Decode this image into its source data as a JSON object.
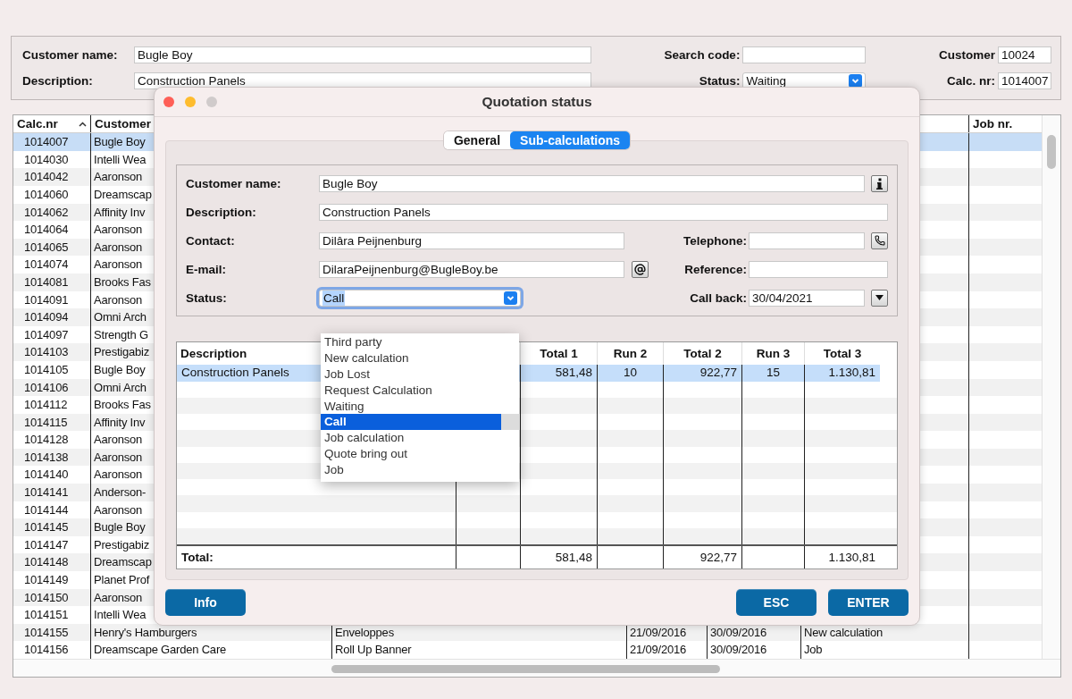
{
  "search_form": {
    "customer_name": {
      "label": "Customer name:",
      "value": "Bugle Boy"
    },
    "description": {
      "label": "Description:",
      "value": "Construction Panels"
    },
    "search_code": {
      "label": "Search code:"
    },
    "status": {
      "label": "Status:",
      "value": "Waiting"
    },
    "customer": {
      "label": "Customer",
      "value": "10024"
    },
    "calc_nr": {
      "label": "Calc. nr:",
      "value": "1014007"
    }
  },
  "table": {
    "columns": [
      {
        "label": "Calc.nr",
        "sort_ascending": true
      },
      {
        "label": "Customer"
      },
      {},
      {},
      {},
      {},
      {
        "label": "Job nr."
      }
    ],
    "rows": [
      {
        "cells": [
          "1014007",
          "Bugle Boy"
        ],
        "selected": true
      },
      {
        "cells": [
          "1014030",
          "Intelli Wea"
        ],
        "selected": false
      },
      {
        "cells": [
          "1014042",
          "Aaronson"
        ],
        "selected": false
      },
      {
        "cells": [
          "1014060",
          "Dreamscap"
        ],
        "selected": false
      },
      {
        "cells": [
          "1014062",
          "Affinity Inv"
        ],
        "selected": false
      },
      {
        "cells": [
          "1014064",
          "Aaronson"
        ],
        "selected": false
      },
      {
        "cells": [
          "1014065",
          "Aaronson"
        ],
        "selected": false
      },
      {
        "cells": [
          "1014074",
          "Aaronson"
        ],
        "selected": false
      },
      {
        "cells": [
          "1014081",
          "Brooks Fas"
        ],
        "selected": false
      },
      {
        "cells": [
          "1014091",
          "Aaronson"
        ],
        "selected": false
      },
      {
        "cells": [
          "1014094",
          "Omni Arch"
        ],
        "selected": false
      },
      {
        "cells": [
          "1014097",
          "Strength G"
        ],
        "selected": false
      },
      {
        "cells": [
          "1014103",
          "Prestigabiz"
        ],
        "selected": false
      },
      {
        "cells": [
          "1014105",
          "Bugle Boy"
        ],
        "selected": false
      },
      {
        "cells": [
          "1014106",
          "Omni Arch"
        ],
        "selected": false
      },
      {
        "cells": [
          "1014112",
          "Brooks Fas"
        ],
        "selected": false
      },
      {
        "cells": [
          "1014115",
          "Affinity Inv"
        ],
        "selected": false
      },
      {
        "cells": [
          "1014128",
          "Aaronson"
        ],
        "selected": false
      },
      {
        "cells": [
          "1014138",
          "Aaronson"
        ],
        "selected": false
      },
      {
        "cells": [
          "1014140",
          "Aaronson"
        ],
        "selected": false
      },
      {
        "cells": [
          "1014141",
          "Anderson-"
        ],
        "selected": false
      },
      {
        "cells": [
          "1014144",
          "Aaronson"
        ],
        "selected": false
      },
      {
        "cells": [
          "1014145",
          "Bugle Boy"
        ],
        "selected": false
      },
      {
        "cells": [
          "1014147",
          "Prestigabiz"
        ],
        "selected": false
      },
      {
        "cells": [
          "1014148",
          "Dreamscap"
        ],
        "selected": false
      },
      {
        "cells": [
          "1014149",
          "Planet Prof"
        ],
        "selected": false
      },
      {
        "cells": [
          "1014150",
          "Aaronson"
        ],
        "selected": false
      },
      {
        "cells": [
          "1014151",
          "Intelli Wea"
        ],
        "selected": false
      },
      {
        "cells": [
          "1014155",
          "Henry's Hamburgers",
          "Enveloppes",
          "21/09/2016",
          "30/09/2016",
          "New calculation"
        ],
        "selected": false
      },
      {
        "cells": [
          "1014156",
          "Dreamscape Garden Care",
          "Roll Up Banner",
          "21/09/2016",
          "30/09/2016",
          "Job"
        ],
        "selected": false
      }
    ]
  },
  "dialog": {
    "title": "Quotation status",
    "tabs": [
      {
        "label": "General",
        "selected": false
      },
      {
        "label": "Sub-calculations",
        "selected": true
      }
    ],
    "form": {
      "customer_name": {
        "label": "Customer name:",
        "value": "Bugle Boy"
      },
      "description": {
        "label": "Description:",
        "value": "Construction Panels"
      },
      "contact": {
        "label": "Contact:",
        "value": "Dilâra Peijnenburg"
      },
      "telephone": {
        "label": "Telephone:"
      },
      "email": {
        "label": "E-mail:",
        "value": "DilaraPeijnenburg@BugleBoy.be"
      },
      "reference": {
        "label": "Reference:"
      },
      "status": {
        "label": "Status:",
        "value": "Call",
        "focused": true
      },
      "call_back": {
        "label": "Call back:",
        "value": "30/04/2021"
      }
    },
    "status_options": [
      {
        "label": "Third party",
        "selected": false
      },
      {
        "label": "New calculation",
        "selected": false
      },
      {
        "label": "Job Lost",
        "selected": false
      },
      {
        "label": "Request Calculation",
        "selected": false
      },
      {
        "label": "Waiting",
        "selected": false
      },
      {
        "label": "Call",
        "selected": true
      },
      {
        "label": "Job calculation",
        "selected": false
      },
      {
        "label": "Quote bring out",
        "selected": false
      },
      {
        "label": "Job",
        "selected": false
      }
    ],
    "sub_table": {
      "columns": [
        {
          "label": "Description"
        },
        {},
        {
          "label": "Total 1"
        },
        {
          "label": "Run 2"
        },
        {
          "label": "Total 2"
        },
        {
          "label": "Run 3"
        },
        {
          "label": "Total 3"
        }
      ],
      "rows": [
        {
          "description": "Construction Panels",
          "total_1": "581,48",
          "run_2": "10",
          "total_2": "922,77",
          "run_3": "15",
          "total_3": "1.130,81",
          "selected": true
        }
      ],
      "totals": {
        "label": "Total:",
        "total_1": "581,48",
        "total_2": "922,77",
        "total_3": "1.130,81"
      }
    },
    "buttons": [
      {
        "label": "Info"
      },
      {
        "label": "ESC"
      },
      {
        "label": "ENTER"
      }
    ]
  }
}
